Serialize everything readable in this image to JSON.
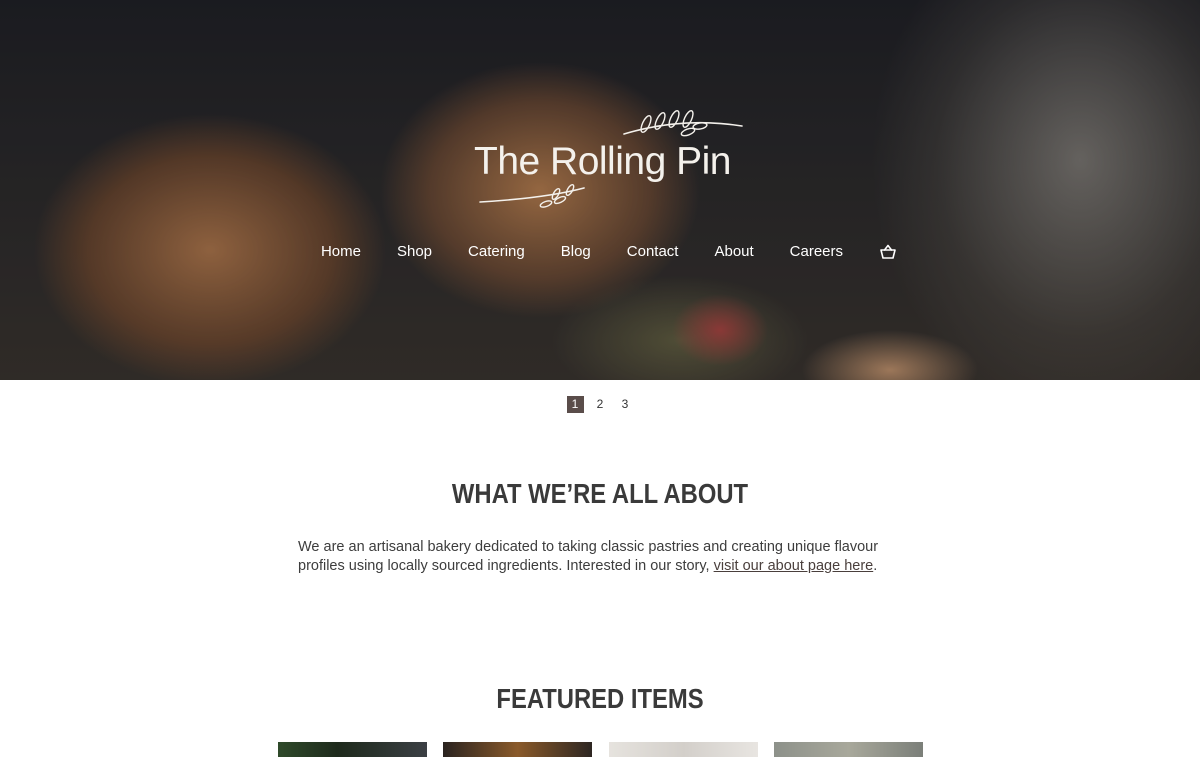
{
  "hero": {
    "logo_text": "The Rolling Pin",
    "nav": [
      {
        "label": "Home"
      },
      {
        "label": "Shop"
      },
      {
        "label": "Catering"
      },
      {
        "label": "Blog"
      },
      {
        "label": "Contact"
      },
      {
        "label": "About"
      },
      {
        "label": "Careers"
      }
    ],
    "cart_icon": "basket-icon"
  },
  "slider_pagination": {
    "pages": [
      "1",
      "2",
      "3"
    ],
    "active_page": "1"
  },
  "about": {
    "title": "WHAT WE’RE ALL ABOUT",
    "text": "We are an artisanal bakery dedicated to taking classic pastries and creating unique flavour profiles using locally sourced ingredients. Interested in our story, ",
    "link_text": "visit our about page here",
    "text_end": "."
  },
  "featured": {
    "title": "FEATURED ITEMS"
  },
  "colors": {
    "active_page_bg": "#5a4d4a",
    "heading": "#3a3a3a",
    "nav_text": "#ffffff"
  }
}
